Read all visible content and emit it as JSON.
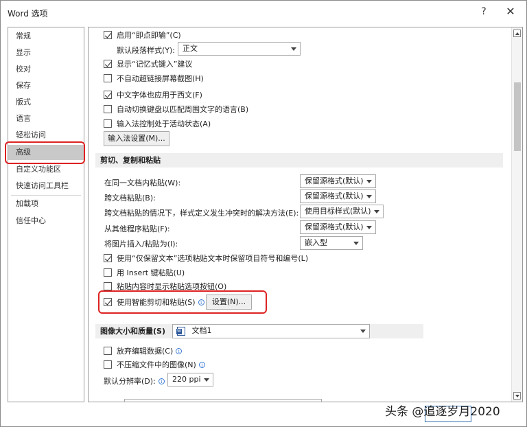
{
  "title": "Word 选项",
  "help_label": "?",
  "close_label": "✕",
  "sidebar": {
    "items": [
      {
        "label": "常规"
      },
      {
        "label": "显示"
      },
      {
        "label": "校对"
      },
      {
        "label": "保存"
      },
      {
        "label": "版式"
      },
      {
        "label": "语言"
      },
      {
        "label": "轻松访问"
      },
      {
        "label": "高级",
        "selected": true
      },
      {
        "label": "自定义功能区"
      },
      {
        "label": "快速访问工具栏"
      },
      {
        "label": "加载项"
      },
      {
        "label": "信任中心"
      }
    ]
  },
  "editing": {
    "enable_ime": {
      "label": "启用“即点即输”(C)",
      "checked": true
    },
    "default_para_style_label": "默认段落样式(Y):",
    "default_para_style_value": "正文",
    "show_autocomplete": {
      "label": "显示“记忆式键入”建议",
      "checked": true
    },
    "no_hyperlink_screenshot": {
      "label": "不自动超链接屏幕截图(H)",
      "checked": false
    },
    "chinese_font_western": {
      "label": "中文字体也应用于西文(F)",
      "checked": true
    },
    "auto_keyboard": {
      "label": "自动切换键盘以匹配周围文字的语言(B)",
      "checked": false
    },
    "ime_active": {
      "label": "输入法控制处于活动状态(A)",
      "checked": false
    },
    "ime_settings_button": "输入法设置(M)..."
  },
  "cut_copy_paste": {
    "section_title": "剪切、复制和粘贴",
    "rows": [
      {
        "label": "在同一文档内粘贴(W):",
        "value": "保留源格式(默认)"
      },
      {
        "label": "跨文档粘贴(B):",
        "value": "保留源格式(默认)"
      },
      {
        "label": "跨文档粘贴的情况下，样式定义发生冲突时的解决方法(E):",
        "value": "使用目标样式(默认)"
      },
      {
        "label": "从其他程序粘贴(F):",
        "value": "保留源格式(默认)"
      },
      {
        "label": "将图片插入/粘贴为(I):",
        "value": "嵌入型"
      }
    ],
    "keep_bullets": {
      "label": "使用“仅保留文本”选项粘贴文本时保留项目符号和编号(L)",
      "checked": true
    },
    "insert_key": {
      "label": "用 Insert 键粘贴(U)",
      "checked": false
    },
    "paste_options_button": {
      "label": "粘贴内容时显示粘贴选项按钮(O)",
      "checked": false
    },
    "smart_cut_paste": {
      "label": "使用智能剪切和粘贴(S)",
      "checked": true
    },
    "settings_button": "设置(N)..."
  },
  "image_quality": {
    "section_title": "图像大小和质量(S)",
    "document": "文档1",
    "discard_edit_data": {
      "label": "放弃编辑数据(C)",
      "checked": false
    },
    "no_compress": {
      "label": "不压缩文件中的图像(N)",
      "checked": false
    },
    "default_resolution_label": "默认分辨率(D):",
    "default_resolution_value": "220 ppi"
  },
  "watermark": "头条 @追逐岁月2020",
  "icons": {
    "info": "info-icon",
    "doc": "word-document-icon",
    "scroll_up": "scroll-up-arrow-icon",
    "scroll_down": "scroll-down-arrow-icon",
    "dropdown": "chevron-down-icon"
  },
  "colors": {
    "highlight_box": "#dd2222",
    "selected_item": "#c9c9c9",
    "section_bg": "#efefef",
    "info_blue": "#3a7bd5"
  }
}
